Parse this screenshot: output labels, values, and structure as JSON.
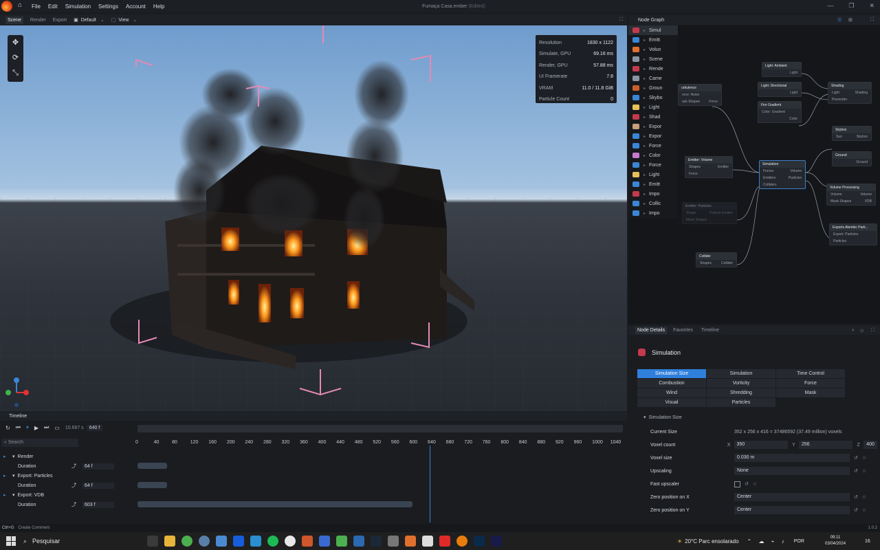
{
  "app": {
    "title": "Fumaça Casa.ember",
    "title_suffix": "(Edited)",
    "menu": [
      "File",
      "Edit",
      "Simulation",
      "Settings",
      "Account",
      "Help"
    ]
  },
  "viewport_toolbar": {
    "tabs": [
      "Scene",
      "Render",
      "Export"
    ],
    "camera": "Default",
    "view": "View"
  },
  "stats": [
    {
      "label": "Resolution",
      "value": "1830 x 1122"
    },
    {
      "label": "Simulate, GPU",
      "value": "69.16 ms"
    },
    {
      "label": "Render, GPU",
      "value": "57.88 ms"
    },
    {
      "label": "UI Framerate",
      "value": "7.8"
    },
    {
      "label": "VRAM",
      "value": "11.0 / 11.8 GiB"
    },
    {
      "label": "Particle Count",
      "value": "0"
    }
  ],
  "node_graph": {
    "title": "Node Graph",
    "list": [
      {
        "label": "Simul",
        "color": "#c23a4c"
      },
      {
        "label": "Emitt",
        "color": "#3b86d6"
      },
      {
        "label": "Volun",
        "color": "#e0702e"
      },
      {
        "label": "Scene",
        "color": "#8b95a2"
      },
      {
        "label": "Rende",
        "color": "#c23a4c"
      },
      {
        "label": "Came",
        "color": "#8b95a2"
      },
      {
        "label": "Groun",
        "color": "#c9602c"
      },
      {
        "label": "Skybo",
        "color": "#3b86d6"
      },
      {
        "label": "Light",
        "color": "#e7c05a"
      },
      {
        "label": "Shad",
        "color": "#c23a4c"
      },
      {
        "label": "Expor",
        "color": "#c6a07a"
      },
      {
        "label": "Expor",
        "color": "#3b86d6"
      },
      {
        "label": "Force",
        "color": "#3b86d6"
      },
      {
        "label": "Color",
        "color": "#c97ad0"
      },
      {
        "label": "Force",
        "color": "#3b86d6"
      },
      {
        "label": "Light",
        "color": "#e7c05a"
      },
      {
        "label": "Emitt",
        "color": "#3b86d6"
      },
      {
        "label": "Impo",
        "color": "#c23a4c"
      },
      {
        "label": "Collic",
        "color": "#3b86d6"
      },
      {
        "label": "Impo",
        "color": "#3b86d6"
      }
    ],
    "nodes": {
      "light_ambient": {
        "title": "Light: Ambient",
        "port": "Light"
      },
      "light_directional": {
        "title": "Light: Directional",
        "port": "Light"
      },
      "shading": {
        "title": "Shading",
        "ports": [
          "Light",
          "Shading",
          "Prerender"
        ]
      },
      "turbulence": {
        "title": "urbulence",
        "sub": "orce: Noise",
        "ports": [
          "ask Shapes",
          "Force"
        ]
      },
      "fire_gradient": {
        "title": "Fire Gradient",
        "sub": "Color: Gradient",
        "port": "Color"
      },
      "skybox": {
        "title": "Skybox",
        "ports": [
          "Sun",
          "Skybox"
        ]
      },
      "ground": {
        "title": "Ground",
        "port": "Ground"
      },
      "emitter_volume": {
        "title": "Emitter: Volume",
        "ports": [
          "Shapes",
          "Emitter",
          "Force"
        ]
      },
      "simulation": {
        "title": "Simulation",
        "ports": [
          "Forces",
          "Volume",
          "Emitters",
          "Particles",
          "Colliders"
        ]
      },
      "emitter_particles": {
        "title": "Emitter: Particles",
        "ports": [
          "Shape",
          "Particle Emitter",
          "Mask Shapes"
        ]
      },
      "volume_processing": {
        "title": "Volume Processing",
        "ports": [
          "Volume",
          "Volume",
          "Mask Shapes",
          "VDB"
        ]
      },
      "export_alembic": {
        "title": "Exports Alembic Parti...",
        "sub": "Export: Particles",
        "port": "Particles"
      },
      "collider": {
        "title": "Collider",
        "ports": [
          "Shapes",
          "Collider"
        ]
      }
    }
  },
  "details_tabs": [
    "Node Details",
    "Favorites",
    "Timeline"
  ],
  "details": {
    "title": "Simulation",
    "categories": [
      "Simulation Size",
      "Simulation",
      "Time Control",
      "Combustion",
      "Vorticity",
      "Force",
      "Wind",
      "Shredding",
      "Mask",
      "Visual",
      "Particles"
    ],
    "section": "Simulation Size",
    "current_size_label": "Current Size",
    "current_size_value": "352 x 256 x 416 = 37486592 (37.49 million) voxels",
    "voxel_count_label": "Voxel count",
    "voxel_x_label": "X",
    "voxel_x": "350",
    "voxel_y_label": "Y",
    "voxel_y": "256",
    "voxel_z_label": "Z",
    "voxel_z": "400",
    "voxel_size_label": "Voxel size",
    "voxel_size": "0.030 m",
    "upscaling_label": "Upscaling",
    "upscaling": "None",
    "fast_upscaler_label": "Fast upscaler",
    "zero_x_label": "Zero position on X",
    "zero_x": "Center",
    "zero_y_label": "Zero position on Y",
    "zero_y": "Center"
  },
  "timeline": {
    "title": "Timeline",
    "time": "10.667 s",
    "frame": "640 f",
    "search_placeholder": "Search",
    "ruler": [
      "0",
      "40",
      "80",
      "120",
      "160",
      "200",
      "240",
      "280",
      "320",
      "360",
      "400",
      "440",
      "480",
      "520",
      "560",
      "600",
      "640",
      "680",
      "720",
      "760",
      "800",
      "840",
      "880",
      "920",
      "960",
      "1000",
      "1040"
    ],
    "playhead_frame": 640,
    "frame_max": 1040,
    "tracks": [
      {
        "name": "Render",
        "duration_label": "Duration",
        "duration": "64 f",
        "frames": 64
      },
      {
        "name": "Export: Particles",
        "duration_label": "Duration",
        "duration": "64 f",
        "frames": 64
      },
      {
        "name": "Export: VDB",
        "duration_label": "Duration",
        "duration": "603 f",
        "frames": 603
      }
    ]
  },
  "status_bar": {
    "shortcut": "Ctrl+G",
    "hint": "Create Comment",
    "version": "1.0.2"
  },
  "taskbar": {
    "search": "Pesquisar",
    "weather": "20°C  Parc ensolarado",
    "lang": "POR",
    "time": "09:11",
    "date": "03/04/2024",
    "notifications": "16"
  }
}
